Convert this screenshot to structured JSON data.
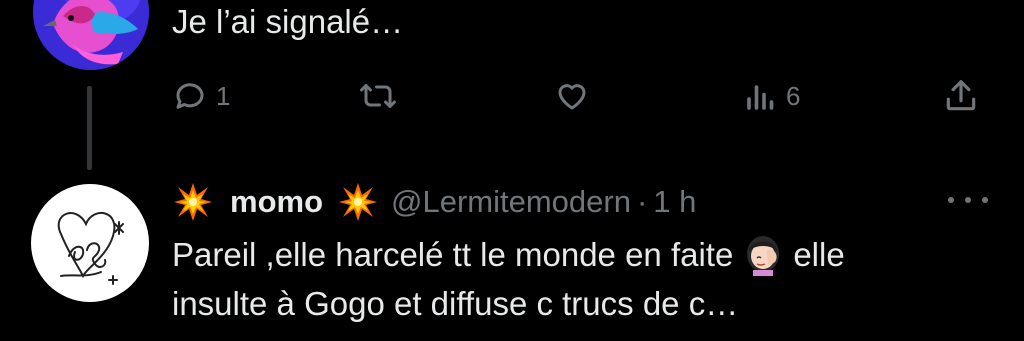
{
  "reply_top": {
    "text": "Je l’ai signalé…",
    "avatar_icon": "bird-avatar"
  },
  "actions": {
    "reply": {
      "icon": "reply-icon",
      "count": "1"
    },
    "retweet": {
      "icon": "retweet-icon",
      "count": ""
    },
    "like": {
      "icon": "heart-icon",
      "count": ""
    },
    "views": {
      "icon": "views-icon",
      "count": "6"
    },
    "share": {
      "icon": "share-icon"
    }
  },
  "reply_bottom": {
    "display_name": "momo",
    "name_emoji": "collision-emoji",
    "handle": "@Lermitemodern",
    "separator": "·",
    "time": "1 h",
    "text_line1_before": "Pareil ,elle harcelé tt le monde en faite",
    "text_line1_after": "elle",
    "text_line2": "insulte à Gogo et diffuse c trucs de c…",
    "inline_emoji": "facepalm-emoji",
    "avatar_icon": "leo-sketch-avatar"
  },
  "colors": {
    "background": "#000000",
    "text_primary": "#e7e9ea",
    "text_secondary": "#71767b",
    "thread_line": "#333639"
  }
}
